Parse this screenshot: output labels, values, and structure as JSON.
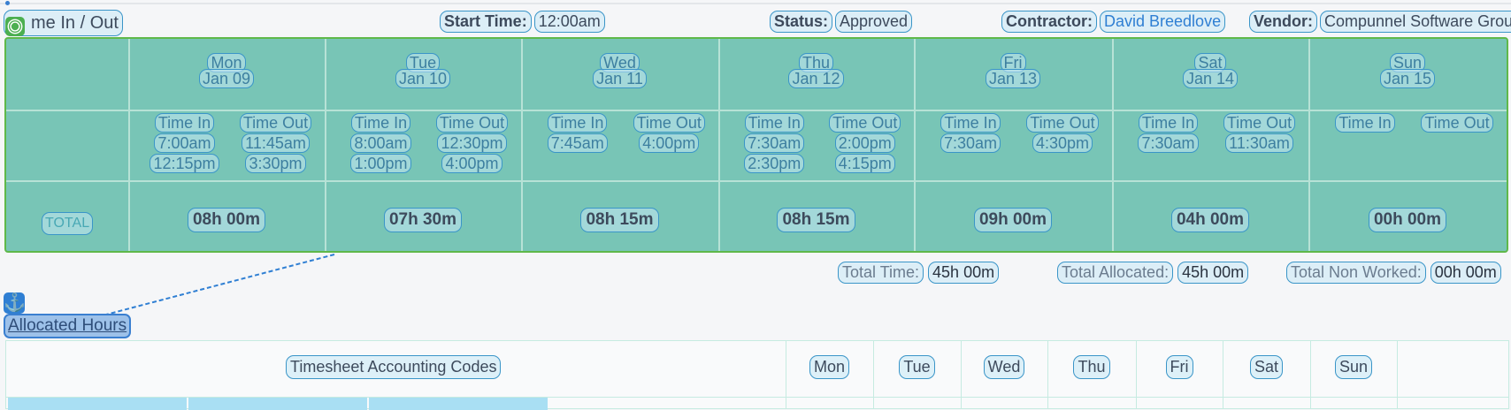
{
  "title": "Time In / Out",
  "title_visible": "me In / Out",
  "header": {
    "start_time_label": "Start Time:",
    "start_time_value": "12:00am",
    "status_label": "Status:",
    "status_value": "Approved",
    "contractor_label": "Contractor:",
    "contractor_value": "David Breedlove",
    "vendor_label": "Vendor:",
    "vendor_value": "Compunnel Software Group"
  },
  "days": [
    {
      "dow": "Mon",
      "date": "Jan 09",
      "total": "08h 00m",
      "time_in": [
        "7:00am",
        "12:15pm"
      ],
      "time_out": [
        "11:45am",
        "3:30pm"
      ]
    },
    {
      "dow": "Tue",
      "date": "Jan 10",
      "total": "07h 30m",
      "time_in": [
        "8:00am",
        "1:00pm"
      ],
      "time_out": [
        "12:30pm",
        "4:00pm"
      ]
    },
    {
      "dow": "Wed",
      "date": "Jan 11",
      "total": "08h 15m",
      "time_in": [
        "7:45am"
      ],
      "time_out": [
        "4:00pm"
      ]
    },
    {
      "dow": "Thu",
      "date": "Jan 12",
      "total": "08h 15m",
      "time_in": [
        "7:30am",
        "2:30pm"
      ],
      "time_out": [
        "2:00pm",
        "4:15pm"
      ]
    },
    {
      "dow": "Fri",
      "date": "Jan 13",
      "total": "09h 00m",
      "time_in": [
        "7:30am"
      ],
      "time_out": [
        "4:30pm"
      ]
    },
    {
      "dow": "Sat",
      "date": "Jan 14",
      "total": "04h 00m",
      "time_in": [
        "7:30am"
      ],
      "time_out": [
        "11:30am"
      ]
    },
    {
      "dow": "Sun",
      "date": "Jan 15",
      "total": "00h 00m",
      "time_in": [],
      "time_out": []
    }
  ],
  "labels": {
    "time_in": "Time In",
    "time_out": "Time Out",
    "total": "TOTAL"
  },
  "summary": {
    "total_time_label": "Total Time:",
    "total_time_value": "45h 00m",
    "total_allocated_label": "Total Allocated:",
    "total_allocated_value": "45h 00m",
    "total_non_worked_label": "Total Non Worked:",
    "total_non_worked_value": "00h 00m"
  },
  "allocated_hours_link": "Allocated Hours",
  "accounting": {
    "codes_header": "Timesheet Accounting Codes",
    "day_headers": [
      "Mon",
      "Tue",
      "Wed",
      "Thu",
      "Fri",
      "Sat",
      "Sun"
    ]
  },
  "colors": {
    "grid_bg": "#78c5b6",
    "grid_border": "#5fb84a",
    "link": "#2f7fd3",
    "pill_border": "#3a95c8"
  }
}
